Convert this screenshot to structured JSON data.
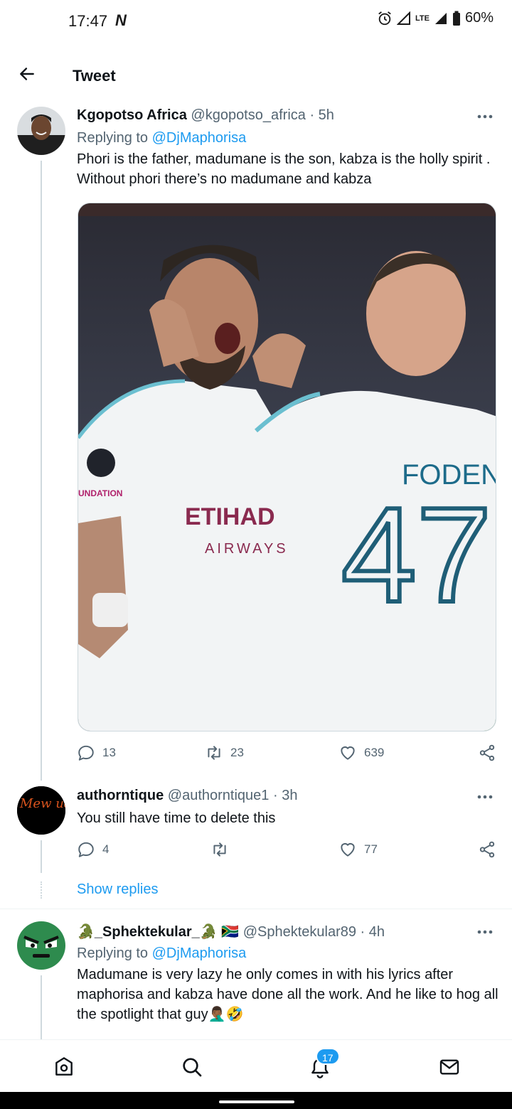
{
  "status_bar": {
    "time": "17:47",
    "carrier_icon": "N",
    "network": "LTE",
    "battery": "60%"
  },
  "header": {
    "title": "Tweet",
    "back_icon": "arrow-left-icon"
  },
  "tweets": [
    {
      "name": "Kgopotso Africa",
      "handle": "@kgopotso_africa",
      "time": "· 5h",
      "replying_prefix": "Replying to ",
      "replying_to": "@DjMaphorisa",
      "text": "Phori is the father, madumane is the son, kabza is the holly spirit . Without phori there’s no madumane and kabza",
      "media": {
        "jersey_name": "FODEN",
        "jersey_number": "47",
        "sponsor": "ETIHAD",
        "sponsor_sub": "AIRWAYS",
        "sleeve_text": "UNDATION"
      },
      "replies": "13",
      "retweets": "23",
      "likes": "639"
    },
    {
      "name": "authorntique",
      "handle": "@authorntique1",
      "time": "· 3h",
      "text": "You still have time to delete this",
      "replies": "4",
      "retweets": "",
      "likes": "77",
      "avatar_text": "Mew udo"
    },
    {
      "name": "🐊_Sphektekular_🐊",
      "flag": "🇿🇦",
      "handle": "@Sphektekular89",
      "time": "· 4h",
      "replying_prefix": "Replying to ",
      "replying_to": "@DjMaphorisa",
      "text": "Madumane is very lazy he only comes in with his lyrics after maphorisa and kabza have done all the work. And he like to hog all the spotlight that guy🤦🏾‍♂️🤣"
    }
  ],
  "show_replies": "Show replies",
  "bottom_nav": {
    "notifications_badge": "17",
    "items": [
      "home-icon",
      "search-icon",
      "notifications-icon",
      "messages-icon"
    ]
  },
  "colors": {
    "accent": "#1d9bf0",
    "secondary_text": "#536471",
    "divider": "#eff3f4"
  }
}
